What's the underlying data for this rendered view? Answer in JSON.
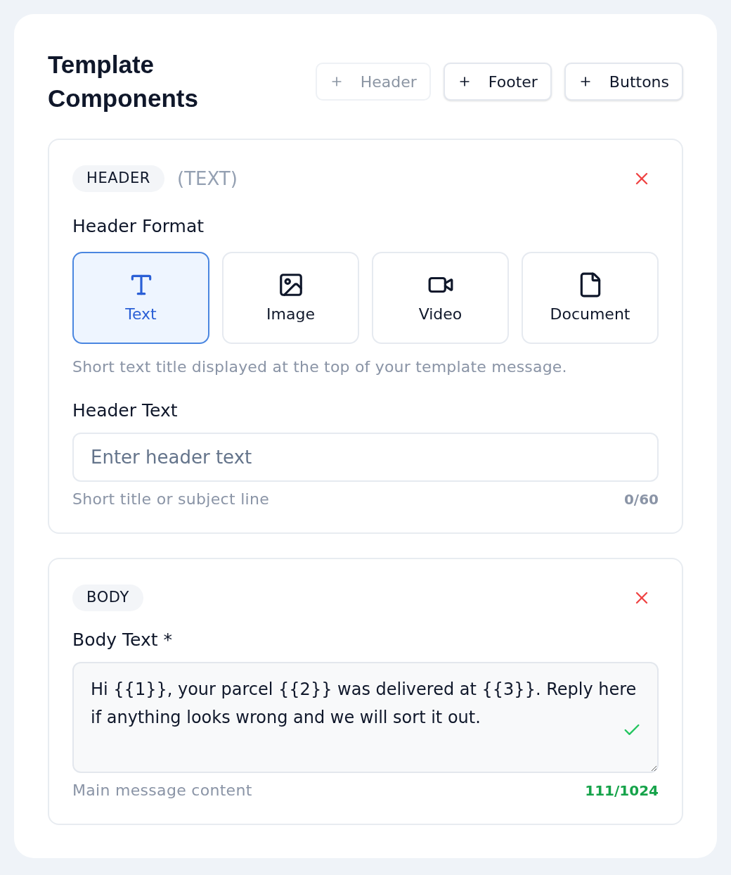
{
  "title": "Template Components",
  "add_buttons": [
    {
      "label": "Header",
      "disabled": true
    },
    {
      "label": "Footer",
      "disabled": false
    },
    {
      "label": "Buttons",
      "disabled": false
    }
  ],
  "sections": [
    {
      "kind": "header",
      "badge": "HEADER",
      "badge_note": "(TEXT)",
      "format_label": "Header Format",
      "formats": [
        {
          "kind": "text",
          "label": "Text",
          "selected": true
        },
        {
          "kind": "image",
          "label": "Image",
          "selected": false
        },
        {
          "kind": "video",
          "label": "Video",
          "selected": false
        },
        {
          "kind": "document",
          "label": "Document",
          "selected": false
        }
      ],
      "format_hint": "Short text title displayed at the top of your template message.",
      "field_label": "Header Text",
      "field": {
        "placeholder": "Enter header text"
      },
      "helper": "Short title or subject line",
      "counter": "0/60"
    },
    {
      "kind": "body",
      "badge": "BODY",
      "field_label": "Body Text *",
      "field": {
        "value": "Hi {{1}}, your parcel {{2}} was delivered at {{3}}. Reply here if anything looks wrong and we will sort it out.",
        "valid": true
      },
      "helper": "Main message content",
      "counter": "111/1024"
    }
  ]
}
